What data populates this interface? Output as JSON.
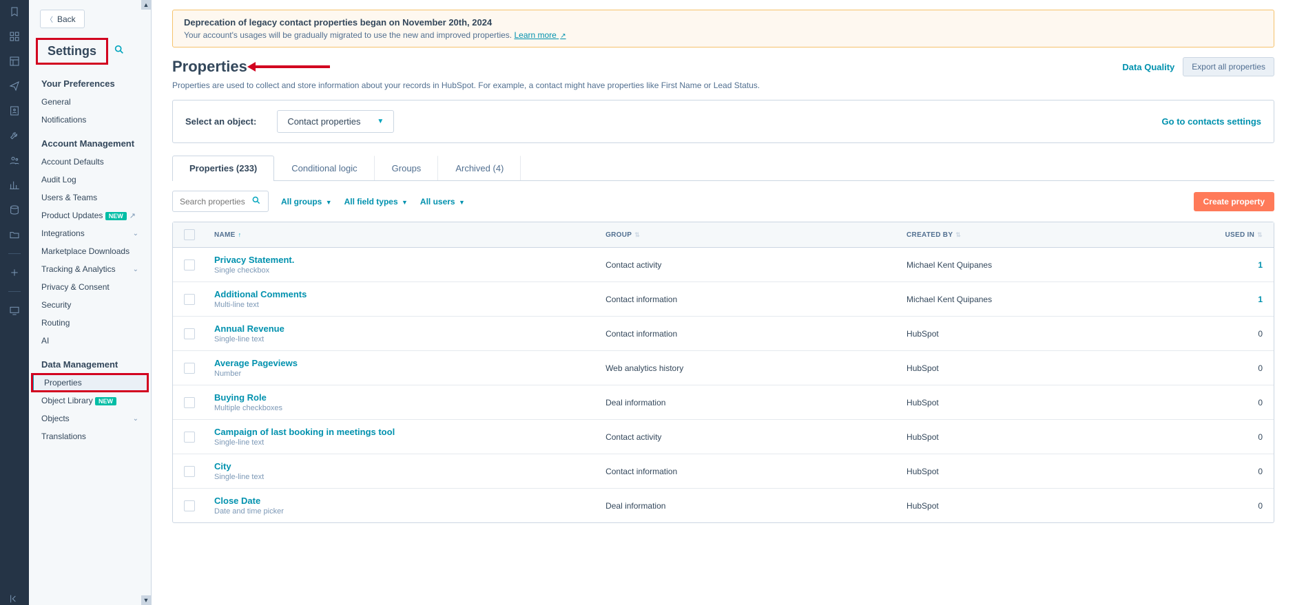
{
  "iconbar": {
    "icons": [
      "bookmark",
      "grid",
      "layout",
      "send",
      "contacts",
      "tool",
      "users",
      "chart",
      "database",
      "folder",
      "divider",
      "plus",
      "divider2",
      "tv",
      "spacer",
      "collapse"
    ]
  },
  "sidebar": {
    "back_label": "Back",
    "heading": "Settings",
    "sections": [
      {
        "title": "Your Preferences",
        "items": [
          {
            "label": "General"
          },
          {
            "label": "Notifications"
          }
        ]
      },
      {
        "title": "Account Management",
        "items": [
          {
            "label": "Account Defaults"
          },
          {
            "label": "Audit Log"
          },
          {
            "label": "Users & Teams"
          },
          {
            "label": "Product Updates",
            "badge": "NEW",
            "ext": true
          },
          {
            "label": "Integrations",
            "caret": true
          },
          {
            "label": "Marketplace Downloads"
          },
          {
            "label": "Tracking & Analytics",
            "caret": true
          },
          {
            "label": "Privacy & Consent"
          },
          {
            "label": "Security"
          },
          {
            "label": "Routing"
          },
          {
            "label": "AI"
          }
        ]
      },
      {
        "title": "Data Management",
        "items": [
          {
            "label": "Properties",
            "active": true,
            "highlight": true
          },
          {
            "label": "Object Library",
            "badge": "NEW"
          },
          {
            "label": "Objects",
            "caret": true
          },
          {
            "label": "Translations"
          }
        ]
      }
    ]
  },
  "banner": {
    "title": "Deprecation of legacy contact properties began on November 20th, 2024",
    "desc": "Your account's usages will be gradually migrated to use the new and improved properties.",
    "link": "Learn more"
  },
  "page": {
    "title": "Properties",
    "desc": "Properties are used to collect and store information about your records in HubSpot. For example, a contact might have properties like First Name or Lead Status.",
    "data_quality": "Data Quality",
    "export": "Export all properties"
  },
  "object_row": {
    "label": "Select an object:",
    "selected": "Contact properties",
    "goto": "Go to contacts settings"
  },
  "tabs": [
    {
      "label": "Properties (233)",
      "active": true
    },
    {
      "label": "Conditional logic"
    },
    {
      "label": "Groups"
    },
    {
      "label": "Archived (4)"
    }
  ],
  "filters": {
    "search_placeholder": "Search properties",
    "groups": "All groups",
    "types": "All field types",
    "users": "All users",
    "create": "Create property"
  },
  "table": {
    "headers": {
      "name": "NAME",
      "group": "GROUP",
      "creator": "CREATED BY",
      "used": "USED IN"
    },
    "rows": [
      {
        "name": "Privacy Statement.",
        "type": "Single checkbox",
        "group": "Contact activity",
        "creator": "Michael Kent Quipanes",
        "used": "1",
        "used_link": true
      },
      {
        "name": "Additional Comments",
        "type": "Multi-line text",
        "group": "Contact information",
        "creator": "Michael Kent Quipanes",
        "used": "1",
        "used_link": true
      },
      {
        "name": "Annual Revenue",
        "type": "Single-line text",
        "group": "Contact information",
        "creator": "HubSpot",
        "used": "0"
      },
      {
        "name": "Average Pageviews",
        "type": "Number",
        "group": "Web analytics history",
        "creator": "HubSpot",
        "used": "0"
      },
      {
        "name": "Buying Role",
        "type": "Multiple checkboxes",
        "group": "Deal information",
        "creator": "HubSpot",
        "used": "0"
      },
      {
        "name": "Campaign of last booking in meetings tool",
        "type": "Single-line text",
        "group": "Contact activity",
        "creator": "HubSpot",
        "used": "0"
      },
      {
        "name": "City",
        "type": "Single-line text",
        "group": "Contact information",
        "creator": "HubSpot",
        "used": "0"
      },
      {
        "name": "Close Date",
        "type": "Date and time picker",
        "group": "Deal information",
        "creator": "HubSpot",
        "used": "0"
      }
    ]
  }
}
